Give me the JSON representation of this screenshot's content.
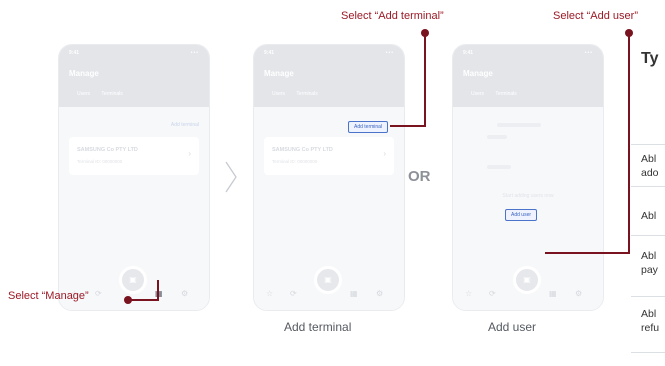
{
  "callouts": {
    "add_terminal": "Select “Add terminal”",
    "add_user": "Select “Add user”",
    "manage": "Select “Manage”"
  },
  "captions": {
    "add_terminal": "Add terminal",
    "add_user": "Add user"
  },
  "or_label": "OR",
  "phone": {
    "time": "9:41",
    "signal": "•••",
    "title": "Manage",
    "tab_users": "Users",
    "tab_terminals": "Terminals",
    "add_terminal_link": "Add terminal",
    "card_name": "SAMSUNG Co PTY LTD",
    "card_sub": "Terminal ID: 00000000",
    "add_terminal_btn": "Add terminal",
    "add_user_btn": "Add user",
    "no_users": "Start adding users now"
  },
  "table": {
    "header": "Ty",
    "rows": [
      [
        "Abl",
        "ado"
      ],
      [
        "Abl"
      ],
      [
        "Abl",
        "pay"
      ],
      [
        "Abl",
        "refu"
      ]
    ]
  },
  "colors": {
    "accent": "#7a1320",
    "callout_text": "#9c1a26",
    "highlight_border": "#4b73c9"
  }
}
